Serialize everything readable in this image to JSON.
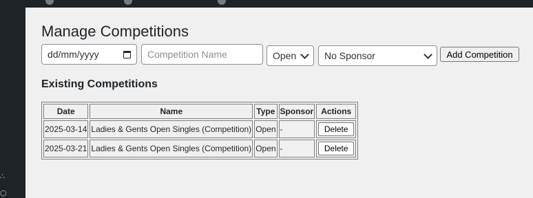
{
  "page": {
    "title": "Manage Competitions",
    "section_title": "Existing Competitions"
  },
  "form": {
    "date_placeholder": "dd/mm/yyyy",
    "name_placeholder": "Competition Name",
    "type_selected": "Open",
    "sponsor_selected": "No Sponsor",
    "add_label": "Add Competition"
  },
  "table": {
    "headers": [
      "Date",
      "Name",
      "Type",
      "Sponsor",
      "Actions"
    ],
    "rows": [
      {
        "date": "2025-03-14",
        "name": "Ladies & Gents Open Singles (Competition)",
        "type": "Open",
        "sponsor": "-",
        "action": "Delete"
      },
      {
        "date": "2025-03-21",
        "name": "Ladies & Gents Open Singles (Competition)",
        "type": "Open",
        "sponsor": "-",
        "action": "Delete"
      }
    ]
  },
  "icons": {
    "calendar": "calendar-icon",
    "dropdown": "chevron-down-icon"
  },
  "colors": {
    "admin_bar": "#1d2327",
    "background": "#f0f0f1",
    "border": "#8c8f94"
  }
}
